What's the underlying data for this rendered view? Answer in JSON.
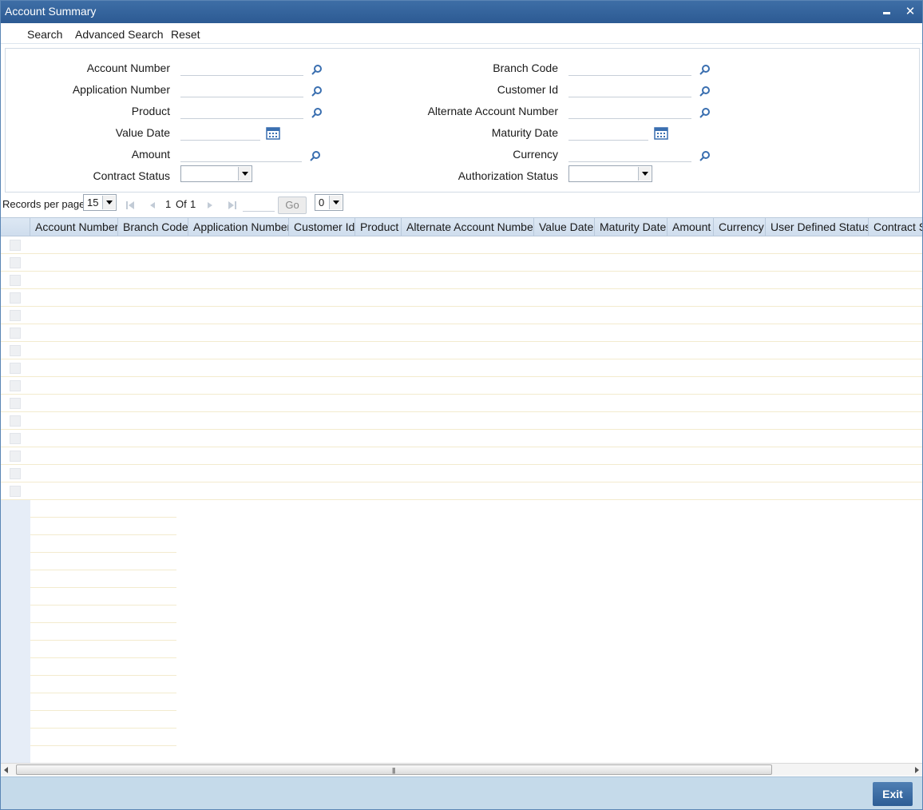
{
  "window": {
    "title": "Account Summary"
  },
  "toolbar": {
    "search": "Search",
    "advanced_search": "Advanced Search",
    "reset": "Reset"
  },
  "criteria": {
    "account_number": {
      "label": "Account Number",
      "value": ""
    },
    "application_number": {
      "label": "Application Number",
      "value": ""
    },
    "product": {
      "label": "Product",
      "value": ""
    },
    "value_date": {
      "label": "Value Date",
      "value": ""
    },
    "amount": {
      "label": "Amount",
      "value": ""
    },
    "contract_status": {
      "label": "Contract Status",
      "value": ""
    },
    "branch_code": {
      "label": "Branch Code",
      "value": ""
    },
    "customer_id": {
      "label": "Customer Id",
      "value": ""
    },
    "alternate_account_number": {
      "label": "Alternate Account Number",
      "value": ""
    },
    "maturity_date": {
      "label": "Maturity Date",
      "value": ""
    },
    "currency": {
      "label": "Currency",
      "value": ""
    },
    "authorization_status": {
      "label": "Authorization Status",
      "value": ""
    }
  },
  "pager": {
    "records_per_page_label": "Records per page",
    "records_per_page": "15",
    "current_page": "1",
    "of_label": "Of",
    "total_pages": "1",
    "go_label": "Go",
    "page_select": "0"
  },
  "grid": {
    "columns": [
      "Account Number",
      "Branch Code",
      "Application Number",
      "Customer Id",
      "Product",
      "Alternate Account Number",
      "Value Date",
      "Maturity Date",
      "Amount",
      "Currency",
      "User Defined Status",
      "Contract S"
    ],
    "row_count": 15
  },
  "footer": {
    "exit_label": "Exit"
  },
  "colors": {
    "title_bar": "#2c5a93",
    "footer": "#c5daea",
    "header_bg": "#cfdded",
    "icon": "#3a6fb0"
  }
}
